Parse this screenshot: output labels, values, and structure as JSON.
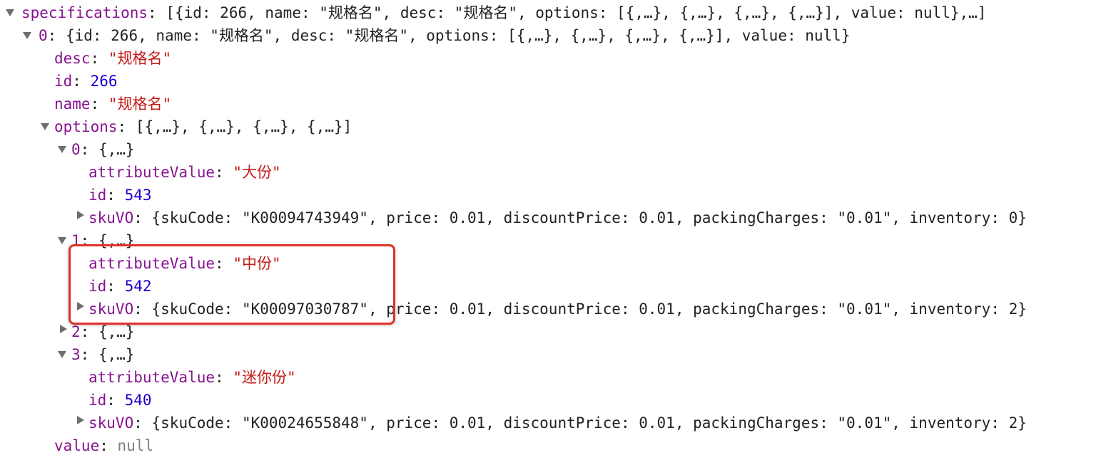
{
  "root": {
    "key": "specifications",
    "preview": "[{id: 266, name: \"规格名\", desc: \"规格名\", options: [{,…}, {,…}, {,…}, {,…}], value: null},…]"
  },
  "spec0": {
    "key": "0",
    "preview": "{id: 266, name: \"规格名\", desc: \"规格名\", options: [{,…}, {,…}, {,…}, {,…}], value: null}",
    "desc": "\"规格名\"",
    "id": "266",
    "name": "\"规格名\"",
    "options_preview": "[{,…}, {,…}, {,…}, {,…}]",
    "value": "null"
  },
  "labels": {
    "desc": "desc",
    "id": "id",
    "name": "name",
    "options": "options",
    "value": "value",
    "attributeValue": "attributeValue",
    "skuVO": "skuVO"
  },
  "options": [
    {
      "key": "0",
      "preview": "{,…}",
      "attributeValue": "\"大份\"",
      "id": "543",
      "skuVO": "{skuCode: \"K00094743949\", price: 0.01, discountPrice: 0.01, packingCharges: \"0.01\", inventory: 0}"
    },
    {
      "key": "1",
      "preview": "{,…}",
      "attributeValue": "\"中份\"",
      "id": "542",
      "skuVO": "{skuCode: \"K00097030787\", price: 0.01, discountPrice: 0.01, packingCharges: \"0.01\", inventory: 2}"
    },
    {
      "key": "2",
      "preview": "{,…}"
    },
    {
      "key": "3",
      "preview": "{,…}",
      "attributeValue": "\"迷你份\"",
      "id": "540",
      "skuVO": "{skuCode: \"K00024655848\", price: 0.01, discountPrice: 0.01, packingCharges: \"0.01\", inventory: 2}"
    }
  ],
  "colors": {
    "key": "#881391",
    "string": "#c41a16",
    "number": "#1c00cf",
    "null": "#808080",
    "highlight": "#e0322a"
  }
}
